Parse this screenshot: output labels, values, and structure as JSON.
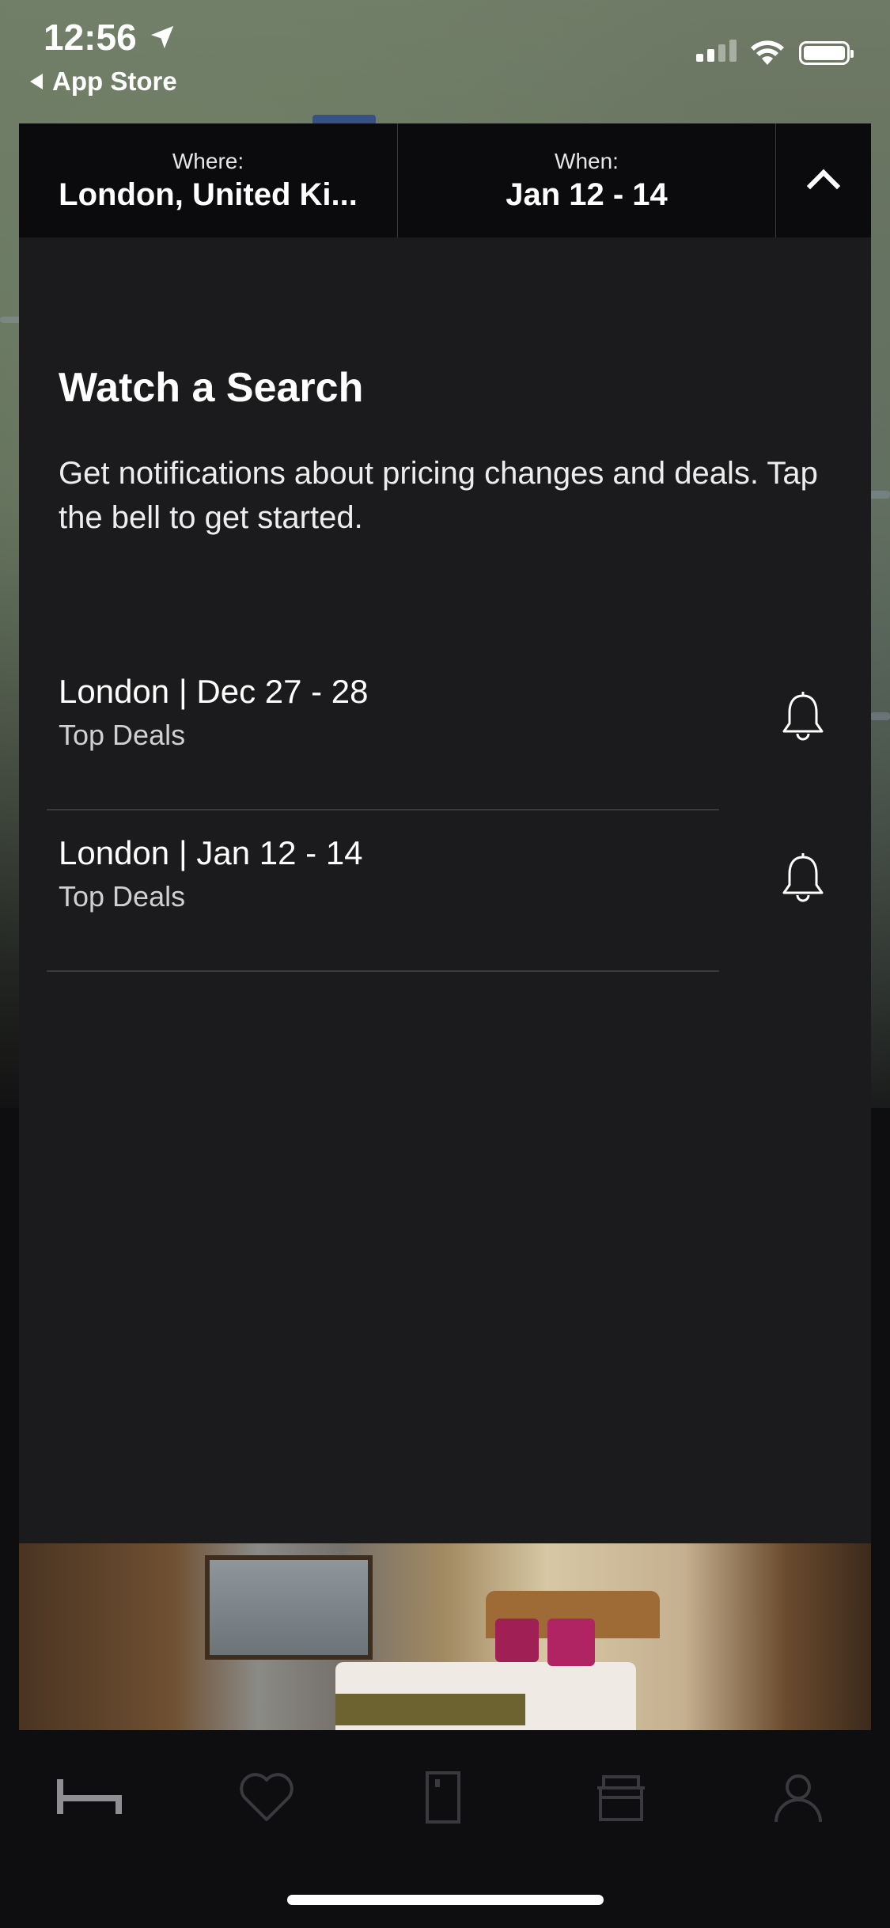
{
  "status_bar": {
    "time": "12:56",
    "back_label": "App Store"
  },
  "search_header": {
    "where_label": "Where:",
    "where_value": "London, United Ki...",
    "when_label": "When:",
    "when_value": "Jan 12 - 14",
    "collapse_icon": "chevron-up-icon"
  },
  "watch_panel": {
    "title": "Watch a Search",
    "description": "Get notifications about pricing changes and deals. Tap the bell to get started.",
    "searches": [
      {
        "title": "London | Dec 27 - 28",
        "subtitle": "Top Deals",
        "icon": "bell-icon"
      },
      {
        "title": "London | Jan 12 - 14",
        "subtitle": "Top Deals",
        "icon": "bell-icon"
      }
    ]
  },
  "tab_bar": {
    "tabs": [
      {
        "icon": "bed-icon",
        "active": true
      },
      {
        "icon": "heart-icon",
        "active": false
      },
      {
        "icon": "door-icon",
        "active": false
      },
      {
        "icon": "gift-icon",
        "active": false
      },
      {
        "icon": "person-icon",
        "active": false
      }
    ],
    "active_color": "#8e8e93",
    "inactive_color": "#3a3a3e"
  },
  "colors": {
    "panel_bg": "#1b1b1d",
    "header_bg": "#0b0b0d",
    "text": "#ffffff"
  }
}
